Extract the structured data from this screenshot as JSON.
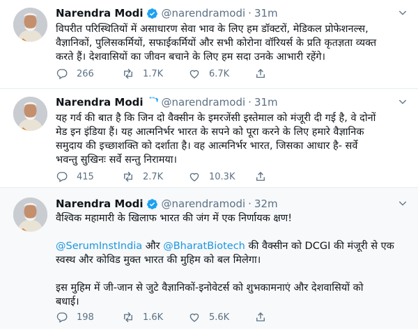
{
  "tweets": [
    {
      "name": "Narendra Modi",
      "handle": "@narendramodi",
      "separator": "·",
      "time": "31m",
      "lines": [
        "विपरीत परिस्थितियों में असाधारण सेवा भाव के लिए हम डॉक्टरों, मेडिकल प्रोफेशनल्स,",
        "वैज्ञानिकों, पुलिसकर्मियों, सफाईकर्मियों और सभी कोरोना वॉरियर्स के प्रति कृतज्ञता व्यक्त",
        "करते हैं। देशवासियों का जीवन बचाने के लिए हम सदा उनके आभारी रहेंगे।"
      ],
      "replies": "266",
      "retweets": "1.7K",
      "likes": "6.7K"
    },
    {
      "name": "Narendra Modi",
      "handle": "@narendramodi",
      "separator": "·",
      "time": "31m",
      "lines": [
        "यह गर्व की बात है कि जिन दो वैक्सीन के इमरजेंसी इस्तेमाल को मंजूरी दी गई है, वे दोनों",
        "मेड इन इंडिया हैं। यह आत्मनिर्भर भारत के सपने को पूरा करने के लिए हमारे वैज्ञानिक",
        "समुदाय की इच्छाशक्ति को दर्शाता है। वह आत्मनिर्भर भारत, जिसका आधार है- सर्वे",
        "भवन्तु सुखिनः सर्वे सन्तु निरामया।"
      ],
      "replies": "415",
      "retweets": "2.7K",
      "likes": "10.3K"
    },
    {
      "name": "Narendra Modi",
      "handle": "@narendramodi",
      "separator": "·",
      "time": "32m",
      "line1": "वैश्विक महामारी के खिलाफ भारत की जंग में एक निर्णायक क्षण!",
      "mention1": "@SerumInstIndia",
      "connector": " और ",
      "mention2": "@BharatBiotech",
      "line2_rest": " की वैक्सीन को DCGI की मंजूरी से एक",
      "line3": "स्वस्थ और कोविड मुक्त भारत की मुहिम को बल मिलेगा।",
      "line4": "इस मुहिम में जी-जान से जुटे वैज्ञानिकों-इनोवेटर्स को शुभकामनाएं और देशवासियों को",
      "line5": "बधाई।",
      "replies": "198",
      "retweets": "1.6K",
      "likes": "5.6K"
    }
  ],
  "icons": {
    "reply": "reply-icon",
    "retweet": "retweet-icon",
    "like": "heart-icon",
    "share": "share-icon",
    "verified": "verified-badge-icon",
    "more": "chevron-down-icon"
  },
  "colors": {
    "text": "#0f1419",
    "secondary": "#5b7083",
    "link": "#1b95e0",
    "verified": "#1da1f2",
    "divider": "#e6ecf0",
    "highlight_bg": "#f7f9fa"
  }
}
